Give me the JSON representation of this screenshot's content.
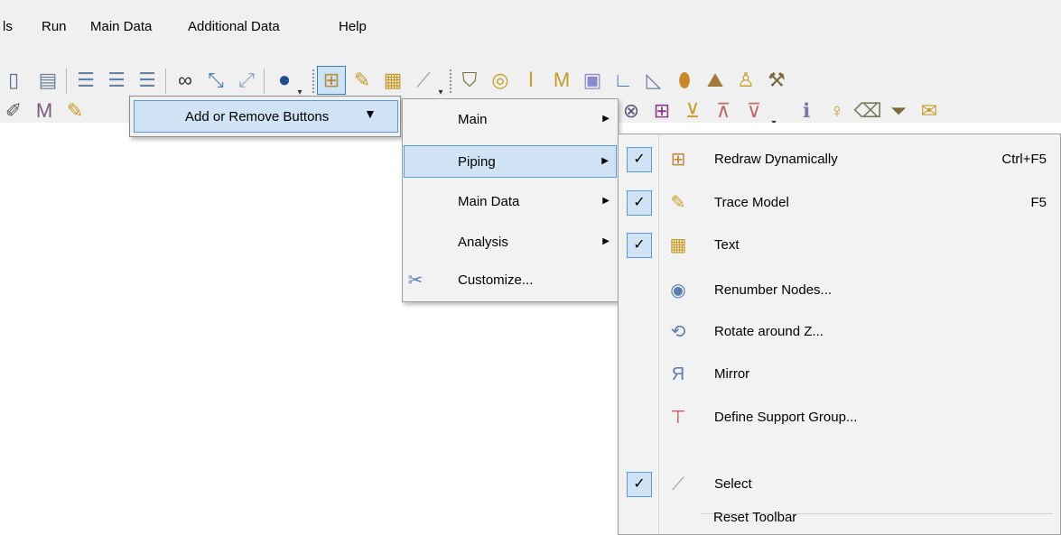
{
  "menubar": {
    "items": [
      "ls",
      "Run",
      "Main Data",
      "Additional Data",
      "Help"
    ]
  },
  "toolbar": {
    "row1_icons": [
      "new-icon",
      "paste-icon",
      "align-left-icon",
      "align-center-icon",
      "align-right-icon",
      "binoculars-icon",
      "edit-diagram-icon",
      "line-icon",
      "help-icon",
      "redraw-icon",
      "trace-model-icon",
      "text-icon",
      "select-icon",
      "valve-icon",
      "ring-icon",
      "beam-icon",
      "material-icon",
      "check-icon",
      "bend-icon",
      "chart-icon",
      "pin-icon",
      "layers-icon",
      "support-icon",
      "tool-icon"
    ],
    "row2_icons": [
      "pen-icon",
      "measure-icon",
      "edit-icon",
      "flange-icon",
      "graph-a-icon",
      "graph-b-icon",
      "graph-c-icon",
      "info-icon",
      "person-icon",
      "eraser-icon",
      "filter-icon",
      "mail-icon"
    ],
    "overflow_symbol": "▾"
  },
  "add_remove": {
    "label": "Add or Remove Buttons",
    "arrow": "▼"
  },
  "submenu_toolbars": {
    "items": [
      {
        "label": "Main",
        "has_submenu": true,
        "selected": false
      },
      {
        "label": "Piping",
        "has_submenu": true,
        "selected": true
      },
      {
        "label": "Main Data",
        "has_submenu": true,
        "selected": false
      },
      {
        "label": "Analysis",
        "has_submenu": true,
        "selected": false
      },
      {
        "label": "Customize...",
        "has_submenu": false,
        "selected": false
      }
    ],
    "submenu_arrow": "▶"
  },
  "piping_menu": {
    "check_mark": "✓",
    "items": [
      {
        "label": "Redraw Dynamically",
        "shortcut": "Ctrl+F5",
        "checked": true,
        "icon": "redraw-icon"
      },
      {
        "label": "Trace Model",
        "shortcut": "F5",
        "checked": true,
        "icon": "trace-model-icon"
      },
      {
        "label": "Text",
        "shortcut": "",
        "checked": true,
        "icon": "text-icon"
      },
      {
        "label": "Renumber Nodes...",
        "shortcut": "",
        "checked": false,
        "icon": "renumber-icon"
      },
      {
        "label": "Rotate around Z...",
        "shortcut": "",
        "checked": false,
        "icon": "rotate-icon"
      },
      {
        "label": "Mirror",
        "shortcut": "",
        "checked": false,
        "icon": "mirror-icon"
      },
      {
        "label": "Define Support Group...",
        "shortcut": "",
        "checked": false,
        "icon": "support-group-icon"
      },
      {
        "label": "Select",
        "shortcut": "",
        "checked": true,
        "icon": "select-icon"
      }
    ],
    "reset_label": "Reset Toolbar"
  }
}
